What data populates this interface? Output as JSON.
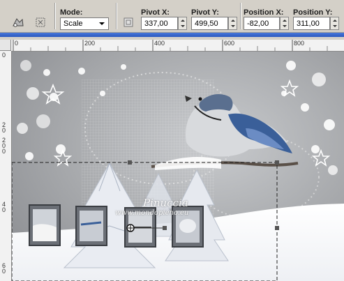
{
  "toolbar": {
    "mode_label": "Mode:",
    "mode_value": "Scale",
    "pivot_x_label": "Pivot X:",
    "pivot_x_value": "337,00",
    "pivot_y_label": "Pivot Y:",
    "pivot_y_value": "499,50",
    "position_x_label": "Position X:",
    "position_x_value": "-82,00",
    "position_y_label": "Position Y:",
    "position_y_value": "311,00"
  },
  "ruler": {
    "h_labels": [
      "0",
      "200",
      "400",
      "600",
      "800"
    ],
    "v_labels": [
      "0",
      "2\n0",
      "2\n0\n0",
      "4\n0",
      "6\n0"
    ]
  },
  "canvas": {
    "watermark_name": "Pinuccia",
    "watermark_url": "www.mondopieno.eu"
  },
  "colors": {
    "accent_bar": "#2a58c0",
    "toolbar_bg": "#d4d0c8",
    "bird_blue": "#3a5f99"
  }
}
